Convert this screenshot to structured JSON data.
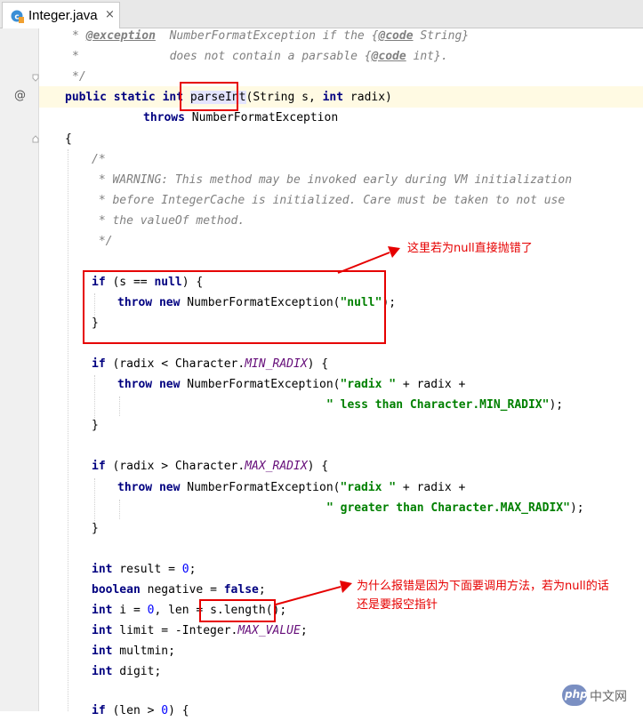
{
  "tab": {
    "title": "Integer.java",
    "close": "×",
    "icon": "java-class-icon"
  },
  "gutter": {
    "override_marker": "@"
  },
  "code": {
    "line1": [
      "* ",
      "@exception",
      "  NumberFormatException if the {",
      "@code",
      " String}"
    ],
    "line2": [
      "*             does not contain a parsable {",
      "@code",
      " int}."
    ],
    "line3": "*/",
    "line4": [
      "public static int ",
      "parseInt",
      "(String s, ",
      "int",
      " radix)"
    ],
    "line5": [
      "throws",
      " NumberFormatException"
    ],
    "line6": "{",
    "c1": "/*",
    "c2": " * WARNING: This method may be invoked early during VM initialization",
    "c3": " * before IntegerCache is initialized. Care must be taken to not use",
    "c4": " * the valueOf method.",
    "c5": " */",
    "if1": [
      "if",
      " (s == ",
      "null",
      ") {"
    ],
    "throw1": [
      "throw new",
      " NumberFormatException(",
      "\"null\"",
      ");"
    ],
    "close1": "}",
    "if2": [
      "if",
      " (radix < Character.",
      "MIN_RADIX",
      ") {"
    ],
    "throw2": [
      "throw new",
      " NumberFormatException(",
      "\"radix \"",
      " + radix +"
    ],
    "throw2b": [
      "\" less than Character.MIN_RADIX\"",
      ");"
    ],
    "close2": "}",
    "if3": [
      "if",
      " (radix > Character.",
      "MAX_RADIX",
      ") {"
    ],
    "throw3": [
      "throw new",
      " NumberFormatException(",
      "\"radix \"",
      " + radix +"
    ],
    "throw3b": [
      "\" greater than Character.MAX_RADIX\"",
      ");"
    ],
    "close3": "}",
    "decl1": [
      "int",
      " result = ",
      "0",
      ";"
    ],
    "decl2": [
      "boolean",
      " negative = ",
      "false",
      ";"
    ],
    "decl3": [
      "int",
      " i = ",
      "0",
      ", len = ",
      "s.length();"
    ],
    "decl4": [
      "int",
      " limit = -Integer.",
      "MAX_VALUE",
      ";"
    ],
    "decl5": [
      "int",
      " multmin;"
    ],
    "decl6": [
      "int",
      " digit;"
    ],
    "partial": [
      "if",
      " (len > ",
      "0",
      ") {"
    ]
  },
  "annotations": {
    "note1": "这里若为null直接抛错了",
    "note2_line1": "为什么报错是因为下面要调用方法，若为null的话",
    "note2_line2": "还是要报空指针"
  },
  "watermark": {
    "badge": "php",
    "text": "中文网"
  },
  "colors": {
    "annotation": "#e60000",
    "keyword": "#000080",
    "string": "#008000",
    "number": "#0000ff",
    "constant": "#660e7a",
    "comment": "#808080"
  }
}
